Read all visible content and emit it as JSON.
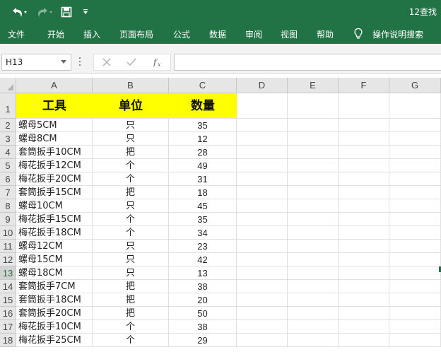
{
  "window": {
    "title": "12查找"
  },
  "tabs": [
    "文件",
    "开始",
    "插入",
    "页面布局",
    "公式",
    "数据",
    "审阅",
    "视图",
    "帮助"
  ],
  "tell_me": "操作说明搜索",
  "name_box": "H13",
  "formula_content": "",
  "columns": [
    "A",
    "B",
    "C",
    "D",
    "E",
    "F",
    "G"
  ],
  "selected_row": 13,
  "header_row": {
    "tool": "工具",
    "unit": "单位",
    "qty": "数量"
  },
  "rows": [
    {
      "tool": "螺母5CM",
      "unit": "只",
      "qty": "35"
    },
    {
      "tool": "螺母8CM",
      "unit": "只",
      "qty": "12"
    },
    {
      "tool": "套筒扳手10CM",
      "unit": "把",
      "qty": "28"
    },
    {
      "tool": "梅花扳手12CM",
      "unit": "个",
      "qty": "49"
    },
    {
      "tool": "梅花扳手20CM",
      "unit": "个",
      "qty": "31"
    },
    {
      "tool": "套筒扳手15CM",
      "unit": "把",
      "qty": "18"
    },
    {
      "tool": "螺母10CM",
      "unit": "只",
      "qty": "45"
    },
    {
      "tool": "梅花扳手15CM",
      "unit": "个",
      "qty": "35"
    },
    {
      "tool": "梅花扳手18CM",
      "unit": "个",
      "qty": "34"
    },
    {
      "tool": "螺母12CM",
      "unit": "只",
      "qty": "23"
    },
    {
      "tool": "螺母15CM",
      "unit": "只",
      "qty": "42"
    },
    {
      "tool": "螺母18CM",
      "unit": "只",
      "qty": "13"
    },
    {
      "tool": "套筒扳手7CM",
      "unit": "把",
      "qty": "38"
    },
    {
      "tool": "套筒扳手18CM",
      "unit": "把",
      "qty": "20"
    },
    {
      "tool": "套筒扳手20CM",
      "unit": "把",
      "qty": "50"
    },
    {
      "tool": "梅花扳手10CM",
      "unit": "个",
      "qty": "38"
    },
    {
      "tool": "梅花扳手25CM",
      "unit": "个",
      "qty": "29"
    }
  ],
  "colors": {
    "ribbon": "#217346",
    "header_fill": "#ffff00"
  },
  "icons": [
    "undo-icon",
    "redo-icon",
    "save-icon",
    "customize-qat-icon",
    "lightbulb-icon",
    "cancel-icon",
    "enter-icon",
    "insert-function-icon"
  ]
}
